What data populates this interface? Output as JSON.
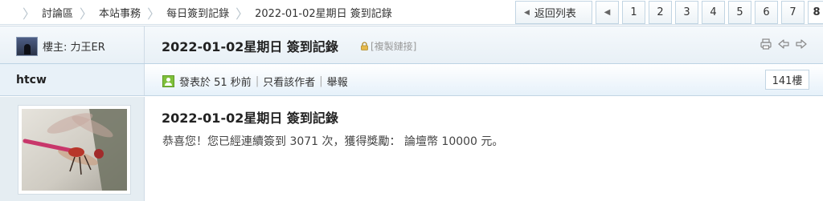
{
  "breadcrumb": [
    "討論區",
    "本站事務",
    "每日簽到記錄",
    "2022-01-02星期日 簽到記錄"
  ],
  "pager": {
    "back_label": "返回列表",
    "pages": [
      "1",
      "2",
      "3",
      "4",
      "5",
      "6",
      "7",
      "8"
    ],
    "current": "8"
  },
  "thread": {
    "owner_label": "樓主: 力王ER",
    "title": "2022-01-02星期日 簽到記錄",
    "copy_link": "[複製鏈接]"
  },
  "post": {
    "author": "htcw",
    "posted": "發表於 51 秒前",
    "only_author": "只看該作者",
    "report": "舉報",
    "floor": "141樓",
    "title": "2022-01-02星期日 簽到記錄",
    "content": "恭喜您！您已經連續簽到 3071 次，獲得獎勵： 論壇幣 10000 元。"
  },
  "colors": {
    "accent": "#7ec03a",
    "border": "#c2d5e3",
    "header_bg": "#e8f0f6"
  }
}
